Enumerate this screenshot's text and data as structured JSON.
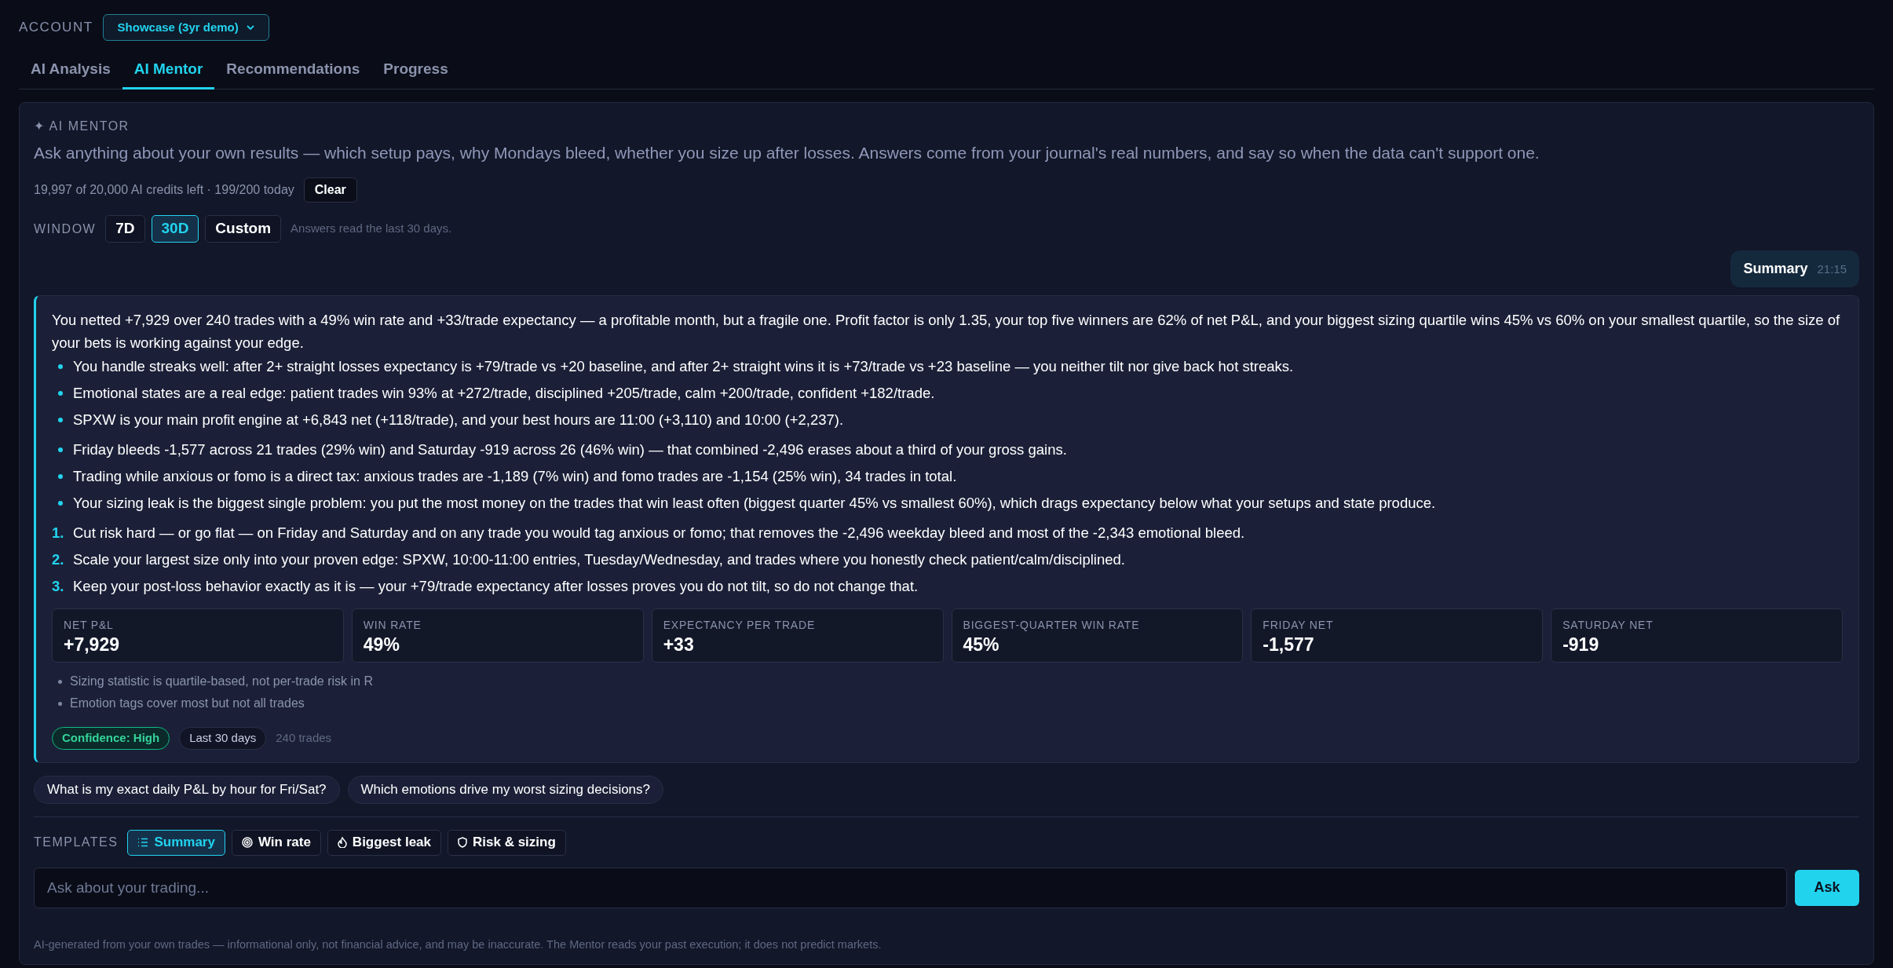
{
  "account": {
    "label": "ACCOUNT",
    "value": "Showcase (3yr demo)"
  },
  "tabs": [
    {
      "label": "AI Analysis",
      "selected": false
    },
    {
      "label": "AI Mentor",
      "selected": true
    },
    {
      "label": "Recommendations",
      "selected": false
    },
    {
      "label": "Progress",
      "selected": false
    }
  ],
  "mentor": {
    "heading": "✦ AI MENTOR",
    "description": "Ask anything about your own results — which setup pays, why Mondays bleed, whether you size up after losses. Answers come from your journal's real numbers, and say so when the data can't support one.",
    "credits": "19,997 of 20,000 AI credits left · 199/200 today",
    "clear_button": "Clear",
    "window": {
      "label": "WINDOW",
      "options": [
        {
          "label": "7D",
          "selected": false
        },
        {
          "label": "30D",
          "selected": true
        },
        {
          "label": "Custom",
          "selected": false
        }
      ],
      "note": "Answers read the last 30 days."
    }
  },
  "user_message": {
    "text": "Summary",
    "time": "21:15"
  },
  "answer": {
    "intro": "You netted +7,929 over 240 trades with a 49% win rate and +33/trade expectancy — a profitable month, but a fragile one. Profit factor is only 1.35, your top five winners are 62% of net P&L, and your biggest sizing quartile wins 45% vs 60% on your smallest quartile, so the size of your bets is working against your edge.",
    "findings": [
      "You handle streaks well: after 2+ straight losses expectancy is +79/trade vs +20 baseline, and after 2+ straight wins it is +73/trade vs +23 baseline — you neither tilt nor give back hot streaks.",
      "Emotional states are a real edge: patient trades win 93% at +272/trade, disciplined +205/trade, calm +200/trade, confident +182/trade.",
      "SPXW is your main profit engine at +6,843 net (+118/trade), and your best hours are 11:00 (+3,110) and 10:00 (+2,237)."
    ],
    "leaks": [
      "Friday bleeds -1,577 across 21 trades (29% win) and Saturday -919 across 26 (46% win) — that combined -2,496 erases about a third of your gross gains.",
      "Trading while anxious or fomo is a direct tax: anxious trades are -1,189 (7% win) and fomo trades are -1,154 (25% win), 34 trades in total.",
      "Your sizing leak is the biggest single problem: you put the most money on the trades that win least often (biggest quarter 45% vs smallest 60%), which drags expectancy below what your setups and state produce."
    ],
    "actions": [
      {
        "number": "1.",
        "text": "Cut risk hard — or go flat — on Friday and Saturday and on any trade you would tag anxious or fomo; that removes the -2,496 weekday bleed and most of the -2,343 emotional bleed."
      },
      {
        "number": "2.",
        "text": "Scale your largest size only into your proven edge: SPXW, 10:00-11:00 entries, Tuesday/Wednesday, and trades where you honestly check patient/calm/disciplined."
      },
      {
        "number": "3.",
        "text": "Keep your post-loss behavior exactly as it is — your +79/trade expectancy after losses proves you do not tilt, so do not change that."
      }
    ],
    "stats": [
      {
        "label": "NET P&L",
        "value": "+7,929"
      },
      {
        "label": "WIN RATE",
        "value": "49%"
      },
      {
        "label": "EXPECTANCY PER TRADE",
        "value": "+33"
      },
      {
        "label": "BIGGEST-QUARTER WIN RATE",
        "value": "45%"
      },
      {
        "label": "FRIDAY NET",
        "value": "-1,577"
      },
      {
        "label": "SATURDAY NET",
        "value": "-919"
      }
    ],
    "caveats": [
      "Sizing statistic is quartile-based, not per-trade risk in R",
      "Emotion tags cover most but not all trades"
    ],
    "badges": [
      {
        "kind": "confidence",
        "text": "Confidence: High"
      },
      {
        "kind": "period",
        "text": "Last 30 days"
      },
      {
        "kind": "count",
        "text": "240 trades"
      }
    ]
  },
  "suggestions": [
    "What is my exact daily P&L by hour for Fri/Sat?",
    "Which emotions drive my worst sizing decisions?"
  ],
  "templates": {
    "label": "TEMPLATES",
    "items": [
      {
        "label": "Summary",
        "selected": true
      },
      {
        "label": "Win rate",
        "selected": false
      },
      {
        "label": "Biggest leak",
        "selected": false
      },
      {
        "label": "Risk & sizing",
        "selected": false
      }
    ]
  },
  "ask": {
    "placeholder": "Ask about your trading...",
    "button": "Ask"
  },
  "disclaimer": "AI-generated from your own trades — informational only, not financial advice, and may be inaccurate. The Mentor reads your past execution; it does not predict markets."
}
